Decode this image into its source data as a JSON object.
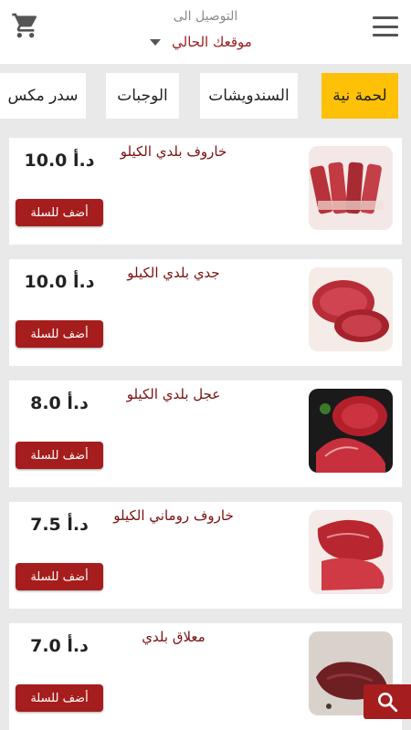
{
  "header": {
    "deliver_label": "التوصيل الى",
    "location": "موقعك الحالي",
    "icons": {
      "cart": "cart-icon",
      "menu": "hamburger-icon",
      "dropdown": "chevron-down-icon"
    }
  },
  "tabs": [
    {
      "label": "لحمة نية",
      "active": true
    },
    {
      "label": "السندويشات",
      "active": false
    },
    {
      "label": "الوجبات",
      "active": false
    },
    {
      "label": "سدر مكس",
      "active": false
    }
  ],
  "products": [
    {
      "name": "خاروف بلدي الكيلو",
      "price": "10.0 د.أ",
      "add_label": "أضف للسلة",
      "image": "lamb-meat-image"
    },
    {
      "name": "جدي بلدي الكيلو",
      "price": "10.0 د.أ",
      "add_label": "أضف للسلة",
      "image": "goat-meat-image"
    },
    {
      "name": "عجل بلدي  الكيلو",
      "price": "8.0 د.أ",
      "add_label": "أضف للسلة",
      "image": "veal-meat-image"
    },
    {
      "name": "خاروف روماني  الكيلو",
      "price": "7.5 د.أ",
      "add_label": "أضف للسلة",
      "image": "romanian-lamb-image"
    },
    {
      "name": "معلاق بلدي",
      "price": "7.0 د.أ",
      "add_label": "أضف للسلة",
      "image": "liver-image"
    }
  ],
  "colors": {
    "accent": "#ffc107",
    "brand": "#a51d1d",
    "title_text": "#7a1010"
  },
  "fab": {
    "icon": "search-icon"
  }
}
